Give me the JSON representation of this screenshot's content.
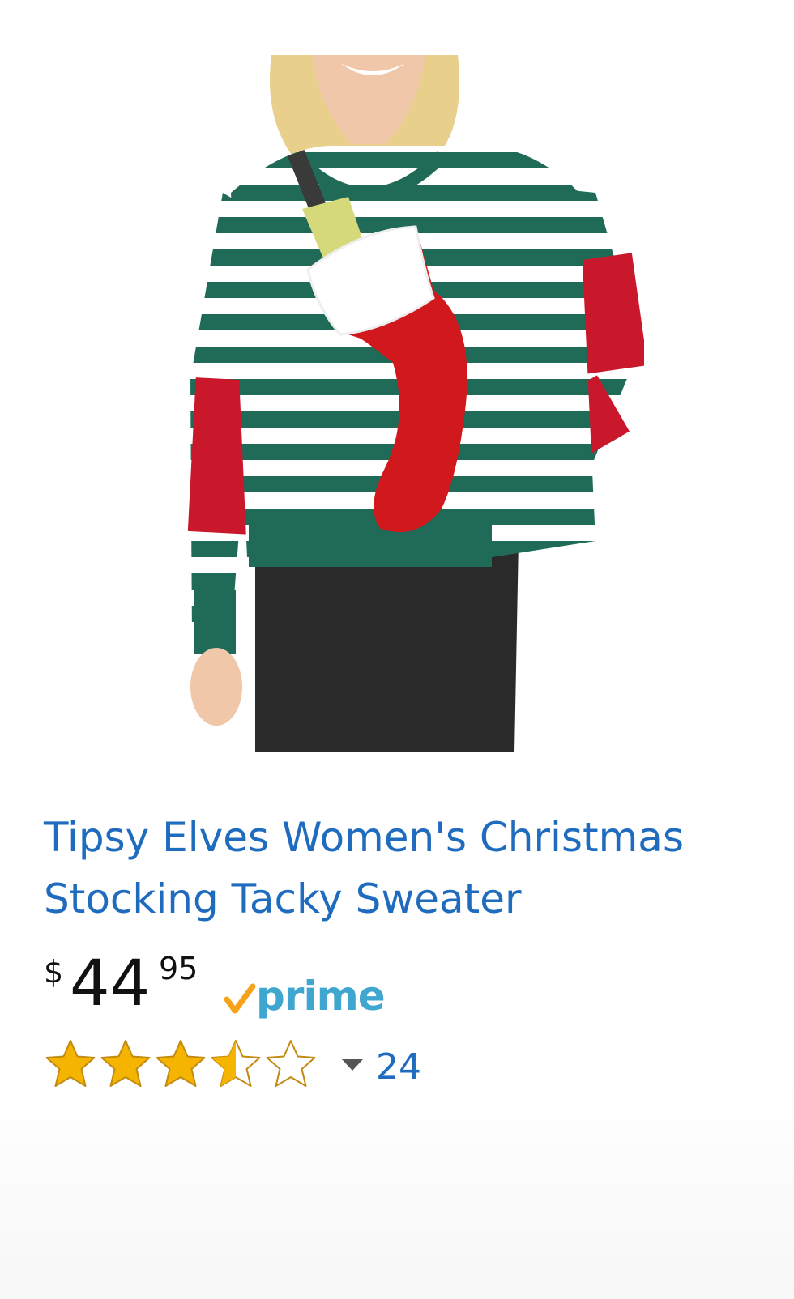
{
  "product": {
    "image_alt": "Woman wearing a green and white striped Christmas sweater with a red stocking holding a wine bottle",
    "title": "Tipsy Elves Women's Christmas Stocking Tacky Sweater",
    "price": {
      "currency_symbol": "$",
      "whole": "44",
      "fraction": "95"
    },
    "prime_label": "prime",
    "rating": {
      "stars": 3.5,
      "max": 5,
      "review_count": "24"
    }
  },
  "colors": {
    "title_link": "#1f6cbf",
    "prime_blue": "#3fa6cf",
    "prime_check": "#f7a21b",
    "star_fill": "#f4b400",
    "star_outline": "#c28a10",
    "sweater_green": "#1f6b57",
    "stocking_red": "#d1191d"
  },
  "icons": [
    "prime-check-icon",
    "star-icon",
    "chevron-down-icon"
  ]
}
